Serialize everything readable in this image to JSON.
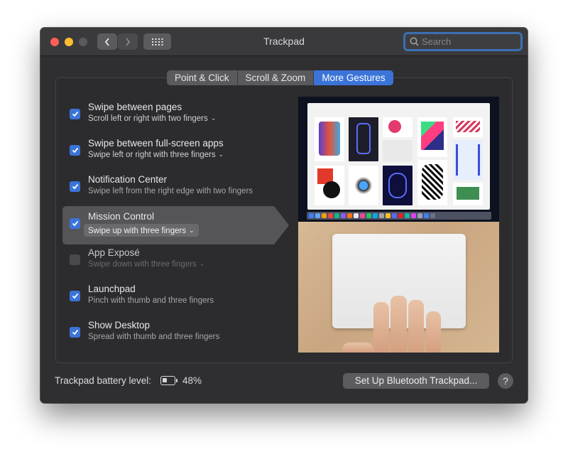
{
  "window": {
    "title": "Trackpad"
  },
  "toolbar": {
    "back_icon": "chevron-left",
    "forward_icon": "chevron-right",
    "grid_icon": "show-all-grid"
  },
  "search": {
    "placeholder": "Search",
    "value": ""
  },
  "tabs": [
    {
      "label": "Point & Click",
      "active": false
    },
    {
      "label": "Scroll & Zoom",
      "active": false
    },
    {
      "label": "More Gestures",
      "active": true
    }
  ],
  "gestures": [
    {
      "title": "Swipe between pages",
      "subtitle": "Scroll left or right with two fingers",
      "checked": true,
      "has_menu": true
    },
    {
      "title": "Swipe between full-screen apps",
      "subtitle": "Swipe left or right with three fingers",
      "checked": true,
      "has_menu": true
    },
    {
      "title": "Notification Center",
      "subtitle": "Swipe left from the right edge with two fingers",
      "checked": true,
      "has_menu": false
    },
    {
      "title": "Mission Control",
      "subtitle": "Swipe up with three fingers",
      "checked": true,
      "has_menu": true,
      "selected": true
    },
    {
      "title": "App Exposé",
      "subtitle": "Swipe down with three fingers",
      "checked": false,
      "has_menu": true
    },
    {
      "title": "Launchpad",
      "subtitle": "Pinch with thumb and three fingers",
      "checked": true,
      "has_menu": false
    },
    {
      "title": "Show Desktop",
      "subtitle": "Spread with thumb and three fingers",
      "checked": true,
      "has_menu": false
    }
  ],
  "footer": {
    "battery_label": "Trackpad battery level:",
    "battery_percent": "48%",
    "battery_level": 0.48,
    "setup_button": "Set Up Bluetooth Trackpad...",
    "help_button": "?"
  },
  "colors": {
    "accent": "#3b74d9",
    "window_bg": "#2f2f31",
    "close": "#ff5f57",
    "minimize": "#febc2e"
  }
}
